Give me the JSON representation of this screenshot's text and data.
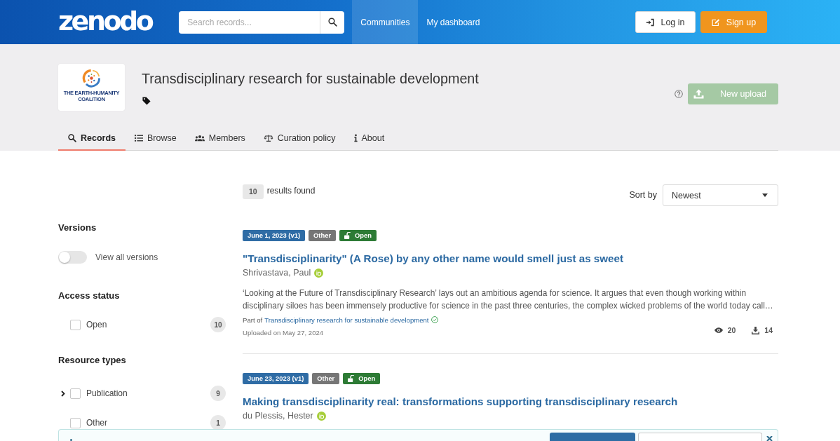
{
  "header": {
    "logo": "zenodo",
    "search": {
      "placeholder": "Search records..."
    },
    "nav": [
      {
        "label": "Communities",
        "selected": true
      },
      {
        "label": "My dashboard",
        "selected": false
      }
    ],
    "buttons": [
      {
        "label": "Log in",
        "kind": "login"
      },
      {
        "label": "Sign up",
        "kind": "signup"
      }
    ]
  },
  "community": {
    "logo_text": "THE EARTH-HUMANITY COALITION",
    "title": "Transdisciplinary research for sustainable development",
    "new_upload": {
      "label": "New upload",
      "disabled": true
    },
    "tabs": [
      {
        "label": "Records",
        "selected": true
      },
      {
        "label": "Browse",
        "selected": false
      },
      {
        "label": "Members",
        "selected": false
      },
      {
        "label": "Curation policy",
        "selected": false
      },
      {
        "label": "About",
        "selected": false
      }
    ]
  },
  "filters": {
    "versions": {
      "title": "Versions",
      "label": "View all versions",
      "on": false
    },
    "facets": [
      {
        "title": "Access status",
        "items": [
          {
            "label": "Open",
            "count": "10",
            "checked": false,
            "kind": "leaf"
          }
        ]
      },
      {
        "title": "Resource types",
        "items": [
          {
            "label": "Publication",
            "count": "9",
            "checked": false,
            "kind": "group",
            "expanded": false
          },
          {
            "label": "Other",
            "count": "1",
            "checked": false,
            "kind": "leaf"
          }
        ]
      }
    ]
  },
  "results": {
    "count": "10",
    "count_label": "results found",
    "sort_label": "Sort by",
    "sort_value": "Newest",
    "records": [
      {
        "date": "June 1, 2023 (v1)",
        "type": "Other",
        "access": "Open",
        "title": "\"Transdisciplinarity\" (A Rose) by any other name would smell just as sweet",
        "author": "Shrivastava, Paul",
        "description": "‘Looking at the Future of Transdisciplinary Research’ lays out an ambitious agenda for science. It argues that even though working within disciplinary siloes has been immensely productive for science in the past three centuries, the complex wicked problems of the world today call…",
        "part_of": "Part of",
        "community": "Transdisciplinary research for sustainable development",
        "uploaded": "Uploaded on May 27, 2024",
        "views": "20",
        "downloads": "14"
      },
      {
        "date": "June 23, 2023 (v1)",
        "type": "Other",
        "access": "Open",
        "title": "Making transdisciplinarity real: transformations supporting transdisciplinary research",
        "author": "du Plessis, Hester"
      }
    ]
  }
}
